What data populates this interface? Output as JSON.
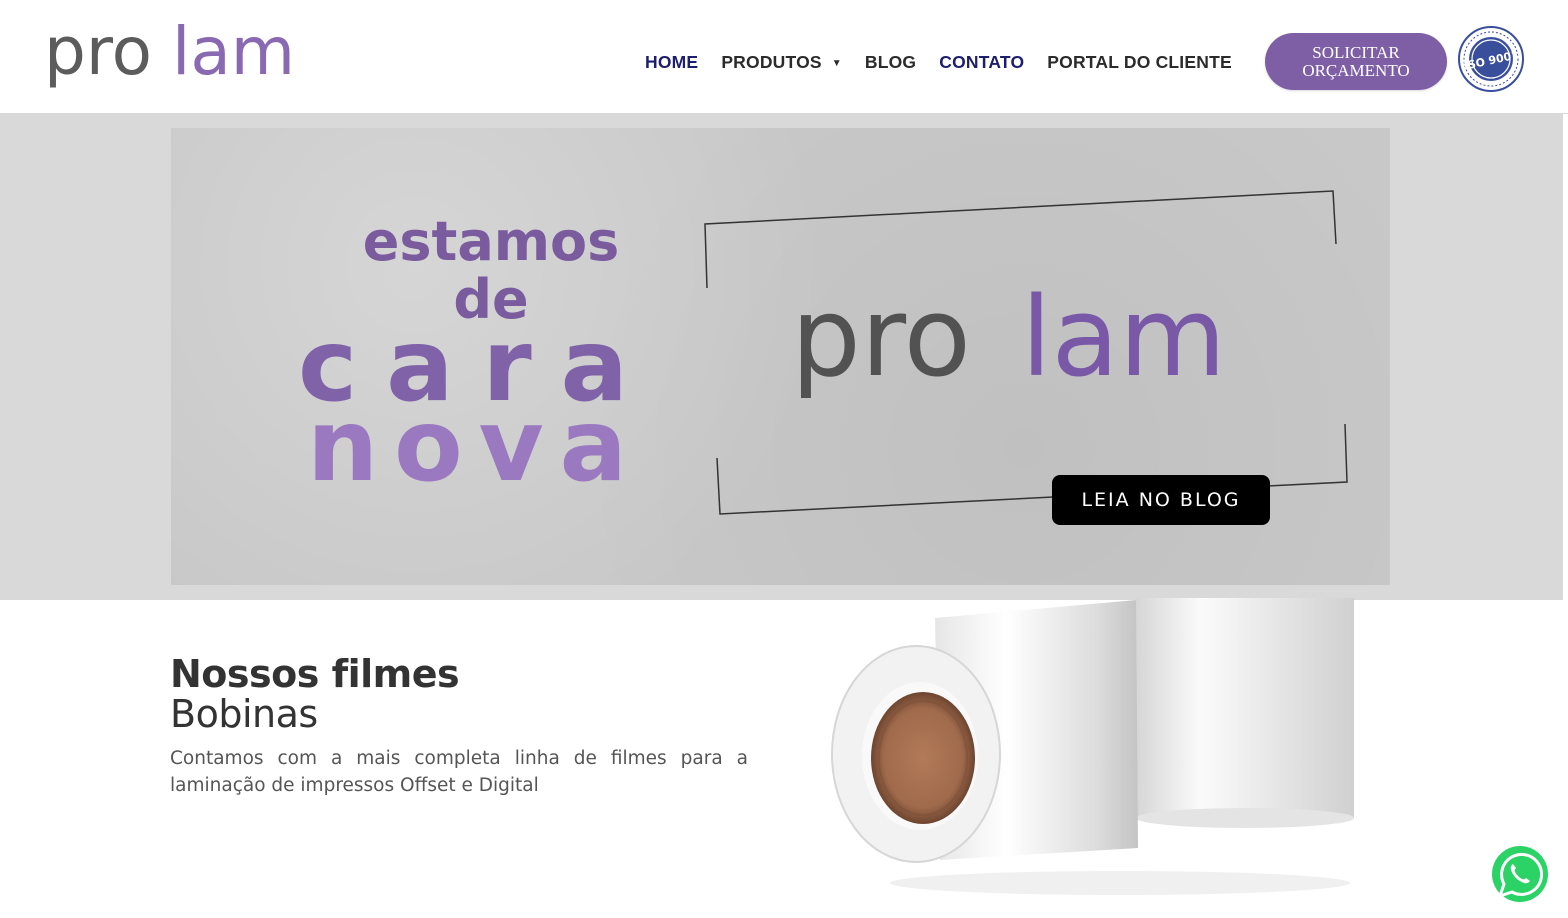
{
  "header": {
    "logo": {
      "part1": "pro",
      "part2": "lam"
    },
    "nav": [
      {
        "label": "HOME"
      },
      {
        "label": "PRODUTOS",
        "has_dropdown": true
      },
      {
        "label": "BLOG"
      },
      {
        "label": "CONTATO"
      },
      {
        "label": "PORTAL DO CLIENTE"
      }
    ],
    "cta": {
      "line1": "SOLICITAR",
      "line2": "ORÇAMENTO"
    },
    "iso_badge": {
      "text": "ISO 9001"
    }
  },
  "banner": {
    "headline": {
      "line1": "estamos",
      "line2": "de",
      "line3": "cara",
      "line4": "nova"
    },
    "logo": {
      "part1": "pro",
      "part2": "lam"
    },
    "button_label": "LEIA NO BLOG"
  },
  "products": {
    "title_bold": "Nossos filmes",
    "title_light": "Bobinas",
    "description": "Contamos com a mais completa linha de filmes para a laminação de impressos Offset e Digital"
  },
  "colors": {
    "brand_purple": "#7e5fa6",
    "logo_gray": "#5c5c5c",
    "nav_dark_blue": "#1d1e6e",
    "banner_bg": "#d9d9d9"
  },
  "icons": {
    "whatsapp": "whatsapp-icon",
    "dropdown": "chevron-down-icon",
    "iso": "iso-9001-seal"
  }
}
